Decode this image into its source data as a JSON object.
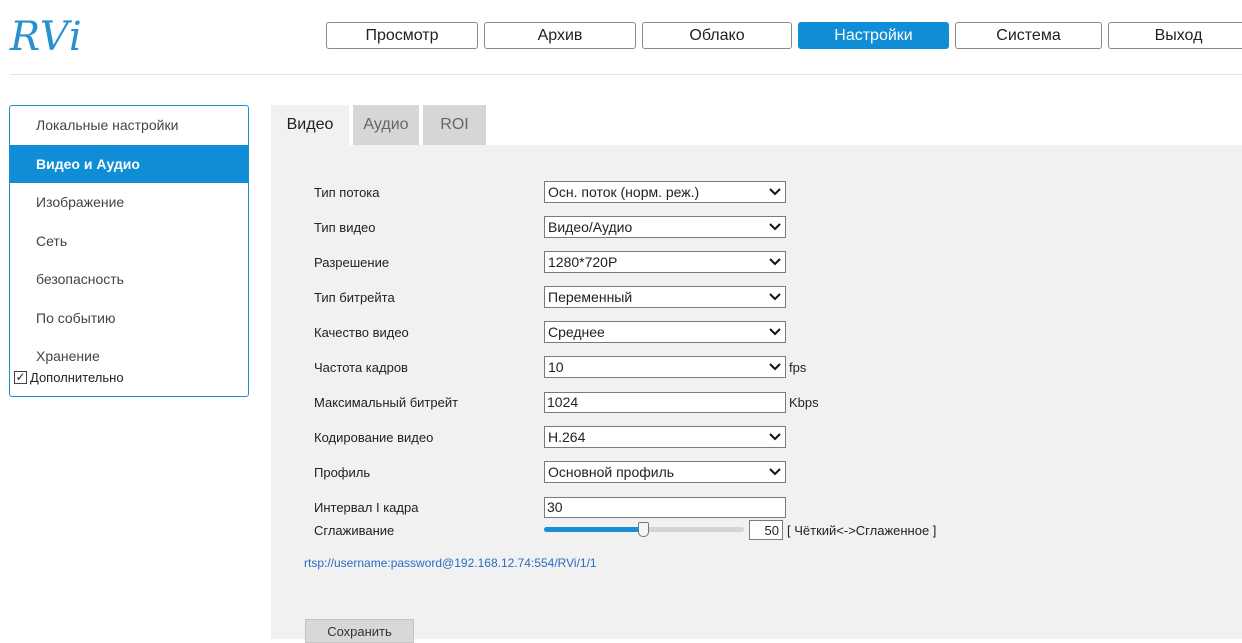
{
  "logo": "RVi",
  "topnav": [
    "Просмотр",
    "Архив",
    "Облако",
    "Настройки",
    "Система",
    "Выход"
  ],
  "sidebar": {
    "items": [
      "Локальные настройки",
      "Видео и Аудио",
      "Изображение",
      "Сеть",
      "безопасность",
      "По событию",
      "Хранение"
    ],
    "extra": "Дополнительно"
  },
  "tabs": [
    "Видео",
    "Аудио",
    "ROI"
  ],
  "form": {
    "stream_type": {
      "label": "Тип потока",
      "value": "Осн. поток (норм. реж.)"
    },
    "video_type": {
      "label": "Тип видео",
      "value": "Видео/Аудио"
    },
    "resolution": {
      "label": "Разрешение",
      "value": "1280*720P"
    },
    "bitrate_type": {
      "label": "Тип битрейта",
      "value": "Переменный"
    },
    "video_quality": {
      "label": "Качество видео",
      "value": "Среднее"
    },
    "frame_rate": {
      "label": "Частота кадров",
      "value": "10",
      "unit": "fps"
    },
    "max_bitrate": {
      "label": "Максимальный битрейт",
      "value": "1024",
      "unit": "Kbps"
    },
    "video_encoding": {
      "label": "Кодирование видео",
      "value": "H.264"
    },
    "profile": {
      "label": "Профиль",
      "value": "Основной профиль"
    },
    "i_frame_interval": {
      "label": "Интервал I кадра",
      "value": "30"
    },
    "smoothing": {
      "label": "Сглаживание",
      "value": "50",
      "hint": "[ Чёткий<->Сглаженное ]",
      "level_percent": 50
    }
  },
  "rtsp_url": "rtsp://username:password@192.168.12.74:554/RVi/1/1",
  "save_label": "Сохранить",
  "colors": {
    "accent": "#0f8dd6",
    "panel_bg": "#f1f1f1",
    "link": "#2a6cc2"
  }
}
